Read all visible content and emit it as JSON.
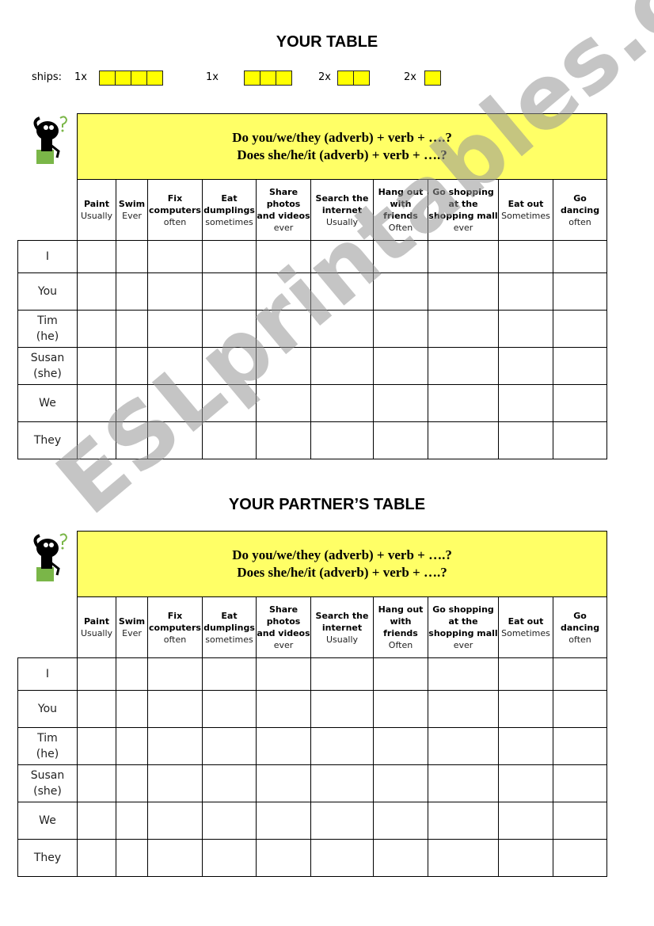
{
  "sections": [
    {
      "title": "YOUR TABLE"
    },
    {
      "title": "YOUR PARTNER’S TABLE"
    }
  ],
  "ships": {
    "label": "ships:",
    "groups": [
      {
        "count": "1x",
        "size": 4
      },
      {
        "count": "1x",
        "size": 3
      },
      {
        "count": "2x",
        "size": 2
      },
      {
        "count": "2x",
        "size": 1
      }
    ]
  },
  "question": {
    "line1": "Do you/we/they (adverb) + verb + ….?",
    "line2": "Does she/he/it (adverb) + verb + ….?"
  },
  "columns": [
    {
      "verb": "Paint",
      "adverb": "Usually"
    },
    {
      "verb": "Swim",
      "adverb": "Ever"
    },
    {
      "verb": "Fix computers",
      "adverb": "often"
    },
    {
      "verb": "Eat dumplings",
      "adverb": "sometimes"
    },
    {
      "verb": "Share photos and videos",
      "adverb": "ever"
    },
    {
      "verb": "Search the internet",
      "adverb": "Usually"
    },
    {
      "verb": "Hang out with friends",
      "adverb": "Often"
    },
    {
      "verb": "Go shopping at the shopping mall",
      "adverb": "ever"
    },
    {
      "verb": "Eat out",
      "adverb": "Sometimes"
    },
    {
      "verb": "Go dancing",
      "adverb": "often"
    }
  ],
  "rows": [
    "I",
    "You",
    "Tim (he)",
    "Susan (she)",
    "We",
    "They"
  ],
  "watermark": "ESLprintables.com",
  "colors": {
    "header_yellow": "#ffff66",
    "ship_yellow": "#ffff00",
    "mascot_green": "#7ab648"
  }
}
